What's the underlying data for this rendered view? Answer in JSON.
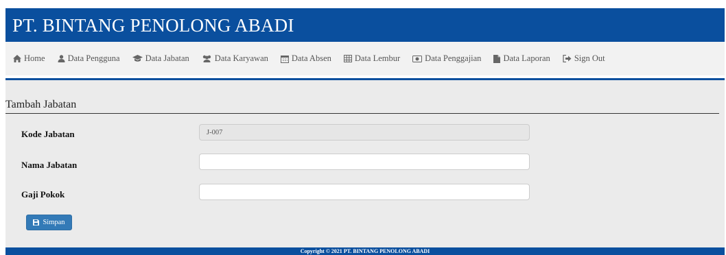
{
  "header": {
    "title": "PT. BINTANG PENOLONG ABADI"
  },
  "nav": {
    "items": [
      {
        "label": "Home",
        "icon": "home-icon"
      },
      {
        "label": "Data Pengguna",
        "icon": "user-icon"
      },
      {
        "label": "Data Jabatan",
        "icon": "graduation-cap-icon"
      },
      {
        "label": "Data Karyawan",
        "icon": "users-icon"
      },
      {
        "label": "Data Absen",
        "icon": "calendar-icon"
      },
      {
        "label": "Data Lembur",
        "icon": "table-icon"
      },
      {
        "label": "Data Penggajian",
        "icon": "money-icon"
      },
      {
        "label": "Data Laporan",
        "icon": "file-icon"
      },
      {
        "label": "Sign Out",
        "icon": "sign-out-icon"
      }
    ]
  },
  "form": {
    "title": "Tambah Jabatan",
    "kode_label": "Kode Jabatan",
    "kode_value": "J-007",
    "nama_label": "Nama Jabatan",
    "nama_value": "",
    "gaji_label": "Gaji Pokok",
    "gaji_value": "",
    "save_label": "Simpan"
  },
  "footer": {
    "text": "Copyright © 2021 PT. BINTANG PENOLONG ABADI"
  },
  "colors": {
    "brand": "#0a4f9e",
    "button": "#337ab7",
    "panel": "#ebebeb",
    "navbar": "#f2f2f2"
  }
}
